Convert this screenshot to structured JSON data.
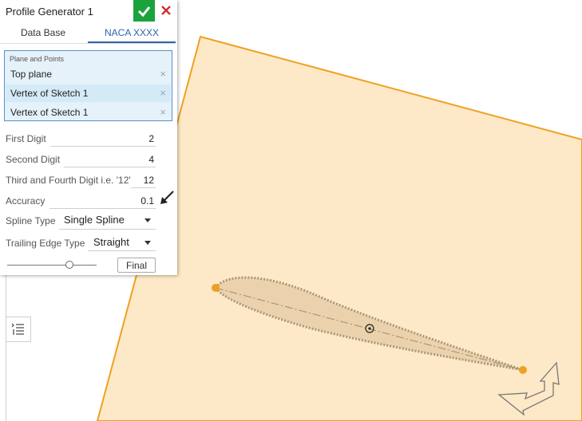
{
  "panel": {
    "title": "Profile Generator 1",
    "tabs": [
      {
        "label": "Data Base",
        "active": false
      },
      {
        "label": "NACA XXXX",
        "active": true
      }
    ],
    "selection": {
      "label": "Plane and Points",
      "items": [
        {
          "label": "Top plane",
          "remove": "×"
        },
        {
          "label": "Vertex of Sketch 1",
          "remove": "×"
        },
        {
          "label": "Vertex of Sketch 1",
          "remove": "×"
        }
      ]
    },
    "fields": [
      {
        "label": "First Digit",
        "value": "2"
      },
      {
        "label": "Second Digit",
        "value": "4"
      },
      {
        "label": "Third and Fourth Digit i.e. '12'",
        "value": "12"
      },
      {
        "label": "Accuracy",
        "value": "0.1"
      }
    ],
    "spline_type": {
      "label": "Spline Type",
      "value": "Single Spline"
    },
    "trailing_edge_type": {
      "label": "Trailing Edge Type",
      "value": "Straight"
    },
    "slider": {
      "position": 0.7
    },
    "final_label": "Final"
  },
  "icons": {
    "confirm": "check-icon",
    "cancel": "close-icon",
    "list": "list-icon",
    "triad": "triad-icon"
  },
  "colors": {
    "confirm": "#1aa33c",
    "cancel": "#d03030",
    "active_tab": "#2f63b0",
    "plane_fill": "#fde9c7",
    "plane_edge": "#f0a020",
    "profile": "#9e8c70",
    "point": "#f0a020"
  }
}
